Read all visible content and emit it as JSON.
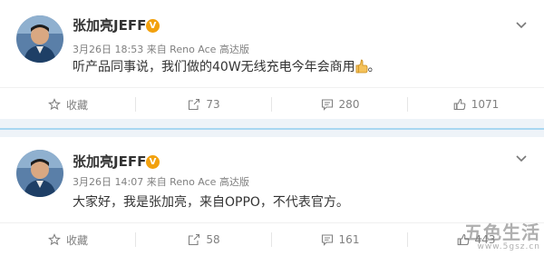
{
  "posts": [
    {
      "user": {
        "name": "张加亮JEFF",
        "verified_badge": "V"
      },
      "meta": "3月26日 18:53 来自 Reno Ace 高达版",
      "content": "听产品同事说，我们做的40W无线充电今年会商用",
      "content_suffix": "。",
      "actions": {
        "favorite_label": "收藏",
        "repost_count": "73",
        "comment_count": "280",
        "like_count": "1071"
      }
    },
    {
      "user": {
        "name": "张加亮JEFF",
        "verified_badge": "V"
      },
      "meta": "3月26日 14:07 来自 Reno Ace 高达版",
      "content": "大家好，我是张加亮，来自OPPO，不代表官方。",
      "actions": {
        "favorite_label": "收藏",
        "repost_count": "58",
        "comment_count": "161",
        "like_count": "443"
      }
    }
  ],
  "watermark": {
    "main": "五色生活",
    "sub": "www.5gsz.cn"
  },
  "colors": {
    "separator_line": "#a8d7f1",
    "badge": "#f2a10e",
    "secondary_text": "#808080"
  },
  "icons": [
    "avatar",
    "verified-badge-icon",
    "chevron-down-icon",
    "thumbs-up-emoji",
    "favorite-icon",
    "repost-icon",
    "comment-icon",
    "like-icon"
  ]
}
